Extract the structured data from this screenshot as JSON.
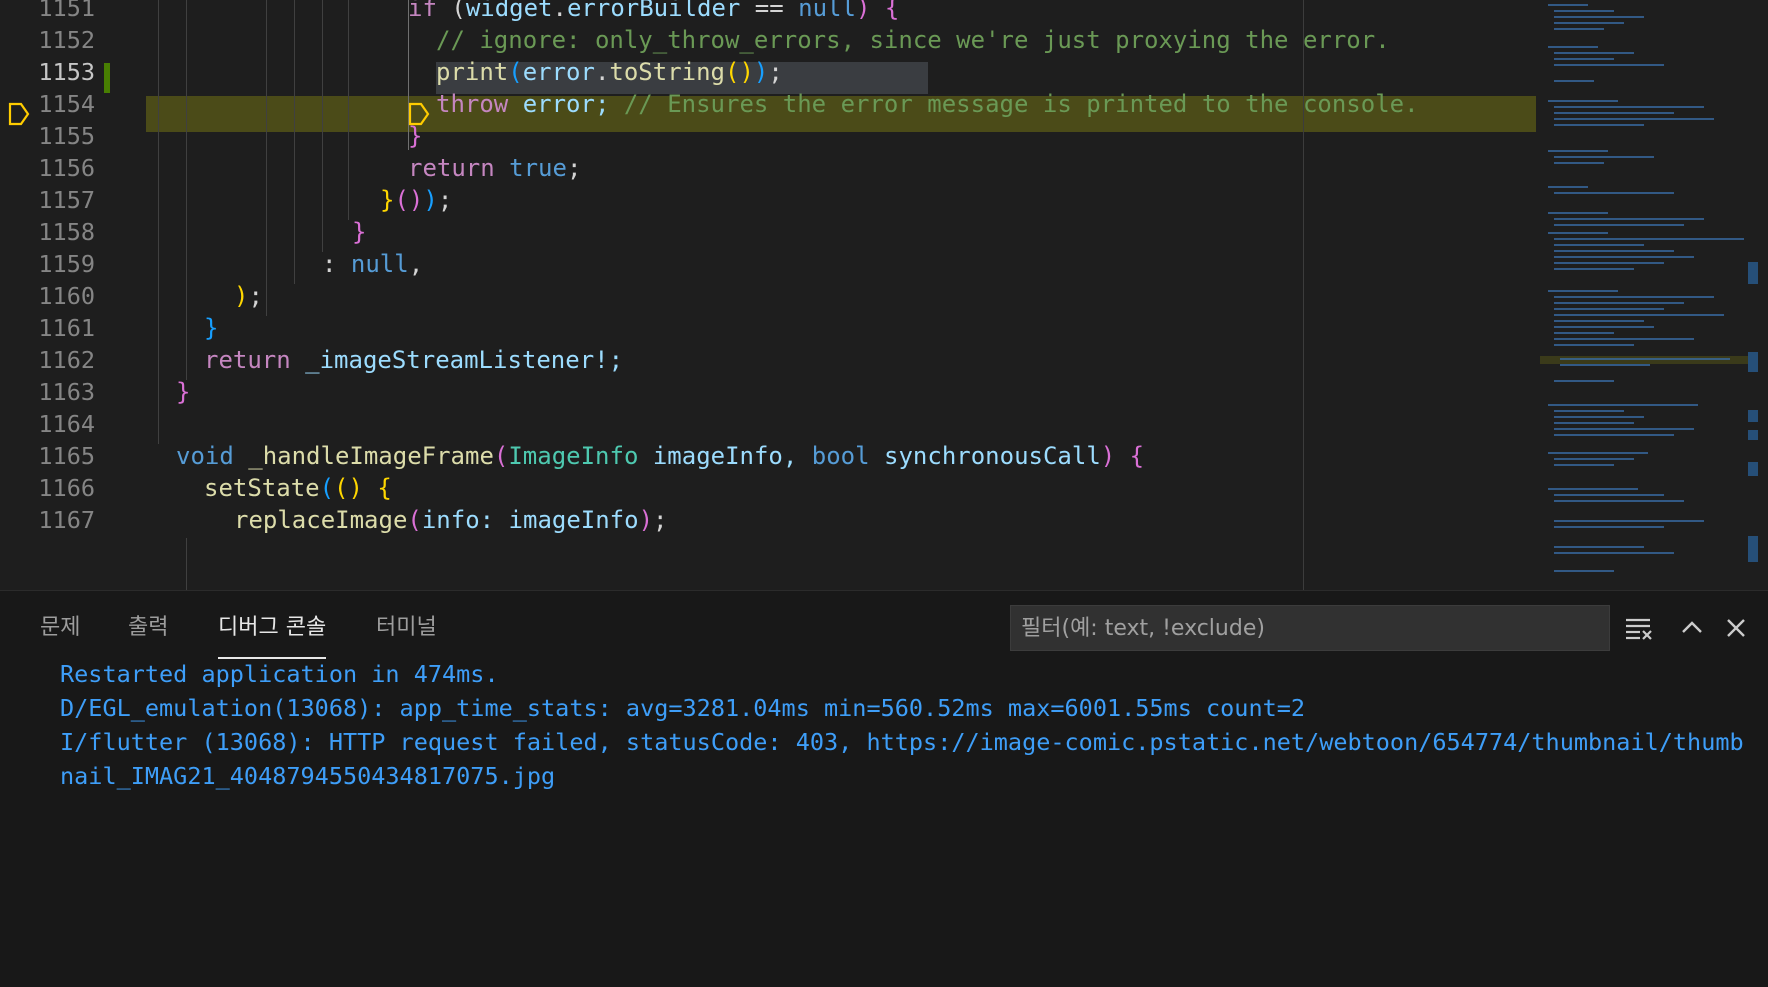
{
  "editor": {
    "line_numbers": [
      "1151",
      "1152",
      "1153",
      "1154",
      "1155",
      "1156",
      "1157",
      "1158",
      "1159",
      "1160",
      "1161",
      "1162",
      "1163",
      "1164",
      "1165",
      "1166",
      "1167"
    ],
    "current_line": "1153",
    "code": {
      "l1151": {
        "a": "if",
        "b": " (",
        "c": "widget",
        "d": ".",
        "e": "errorBuilder",
        "f": " == ",
        "g": "null",
        "h": ")",
        "i": " {"
      },
      "l1152": {
        "a": "// ignore: only_throw_errors, since we're just proxying the error."
      },
      "l1153": {
        "a": "print",
        "b": "(",
        "c": "error",
        "d": ".",
        "e": "toString",
        "f": "()",
        "g": ")",
        "h": ";"
      },
      "l1154": {
        "a": "throw",
        "b": " error; ",
        "c": "// Ensures the error message is printed to the console."
      },
      "l1155": {
        "a": "}"
      },
      "l1156": {
        "a": "return",
        "b": " ",
        "c": "true",
        "d": ";"
      },
      "l1157": {
        "a": "}",
        "b": "()",
        "c": ")",
        "d": ";"
      },
      "l1158": {
        "a": "}"
      },
      "l1159": {
        "a": ": ",
        "b": "null",
        "c": ","
      },
      "l1160": {
        "a": ")",
        "b": ";"
      },
      "l1161": {
        "a": "}"
      },
      "l1162": {
        "a": "return",
        "b": " _imageStreamListener!;"
      },
      "l1163": {
        "a": "}"
      },
      "l1164": {},
      "l1165": {
        "a": "void",
        "b": " ",
        "c": "_handleImageFrame",
        "d": "(",
        "e": "ImageInfo",
        "f": " imageInfo, ",
        "g": "bool",
        "h": " synchronousCall",
        "i": ")",
        "j": " {"
      },
      "l1166": {
        "a": "setState",
        "b": "(",
        "c": "()",
        "d": " {"
      },
      "l1167": {
        "a": "replaceImage",
        "b": "(",
        "c": "info: imageInfo",
        "d": ")",
        "e": ";"
      }
    }
  },
  "panel": {
    "tabs": [
      {
        "label": "문제"
      },
      {
        "label": "출력"
      },
      {
        "label": "디버그 콘솔"
      },
      {
        "label": "터미널"
      }
    ],
    "active_tab": "디버그 콘솔",
    "filter_placeholder": "필터(예: text, !exclude)",
    "console_lines": [
      "Restarted application in 474ms.",
      "D/EGL_emulation(13068): app_time_stats: avg=3281.04ms min=560.52ms max=6001.55ms count=2",
      "I/flutter (13068): HTTP request failed, statusCode: 403, https://image-comic.pstatic.net/webtoon/654774/thumbnail/thumbnail_IMAG21_4048794550434817075.jpg"
    ],
    "icons": [
      "clear-console-icon",
      "maximize-panel-icon",
      "close-panel-icon"
    ]
  },
  "colors": {
    "accent": "#3e9ef8",
    "breakpoint": "#ffcc00",
    "modified": "#487e02"
  }
}
